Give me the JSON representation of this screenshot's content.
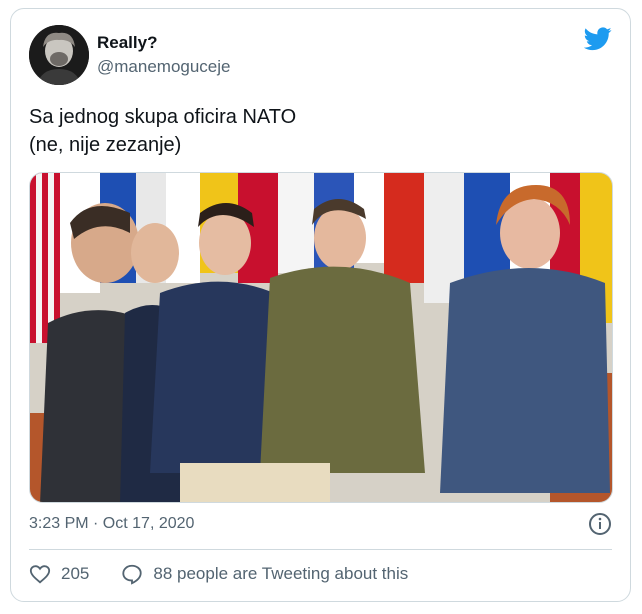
{
  "tweet": {
    "display_name": "Really?",
    "handle": "@manemoguceje",
    "text_lines": [
      "Sa jednog skupa oficira NATO",
      "(ne, nije zezanje)"
    ],
    "timestamp": "3:23 PM · Oct 17, 2020"
  },
  "actions": {
    "like_count": "205",
    "reply_text": "88 people are Tweeting about this"
  },
  "icons": {
    "brand": "twitter-bird-icon",
    "info": "info-icon",
    "like": "heart-icon",
    "reply": "chat-bubble-icon"
  },
  "colors": {
    "brand": "#1d9bf0",
    "text_primary": "#0f1419",
    "text_secondary": "#536471",
    "border": "#cfd9de"
  }
}
